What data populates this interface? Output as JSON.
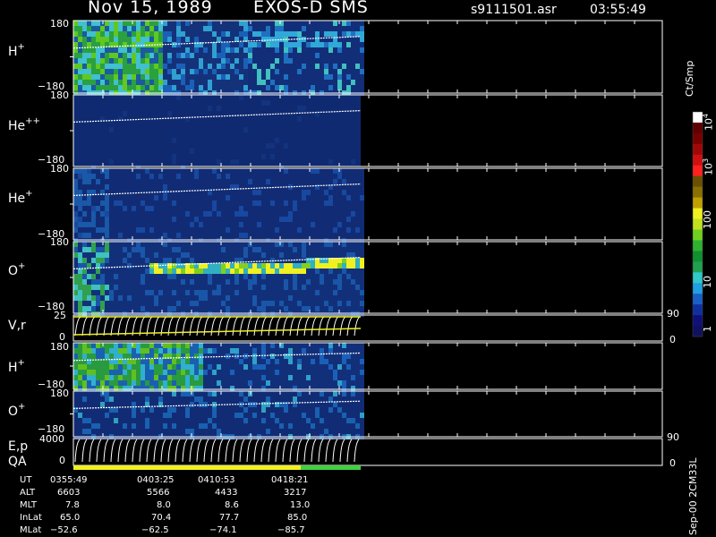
{
  "header": {
    "date": "Nov 15, 1989",
    "instrument": "EXOS-D SMS",
    "file": "s9111501.asr",
    "time": "03:55:49"
  },
  "colorbar": {
    "unit_label": "Ct/Smp",
    "tick_labels": [
      "1",
      "10",
      "100",
      "10",
      "10"
    ],
    "tick_exponents": [
      "",
      "",
      "",
      "3",
      "4"
    ],
    "colors": [
      "#101060",
      "#101078",
      "#1030a0",
      "#1860c8",
      "#20a0e0",
      "#30c8c8",
      "#20a050",
      "#109030",
      "#30b030",
      "#70d020",
      "#c0e020",
      "#f0f020",
      "#c0a000",
      "#8a7000",
      "#6a5000",
      "#ff2020",
      "#d01010",
      "#a00808",
      "#780000",
      "#600000",
      "#ffffff"
    ]
  },
  "side_label": "Sep-00 2CM33L",
  "panels": [
    {
      "label": "H",
      "sup": "+",
      "ymax": "180",
      "ymin": "−180",
      "color_theme": "green"
    },
    {
      "label": "He",
      "sup": "++",
      "ymax": "180",
      "ymin": "−180",
      "color_theme": "dark"
    },
    {
      "label": "He",
      "sup": "+",
      "ymax": "180",
      "ymin": "−180",
      "color_theme": "dark"
    },
    {
      "label": "O",
      "sup": "+",
      "ymax": "180",
      "ymin": "−180",
      "color_theme": "mixed"
    },
    {
      "label": "H",
      "sup": "+",
      "ymax": "180",
      "ymin": "−180",
      "color_theme": "green"
    },
    {
      "label": "O",
      "sup": "+",
      "ymax": "180",
      "ymin": "−180",
      "color_theme": "dark"
    }
  ],
  "vr_panel": {
    "label": "V,r",
    "ymax": "25",
    "ymin": "0",
    "right_top": "90",
    "right_bottom": "0"
  },
  "ep_panel": {
    "label1": "E,p",
    "label2": "QA",
    "ymax": "4000",
    "ymin": "0",
    "right_top": "90",
    "right_bottom": "0"
  },
  "footer": {
    "rows": [
      {
        "name": "UT",
        "values": [
          "0355:49",
          "0403:25",
          "0410:53",
          "0418:21"
        ]
      },
      {
        "name": "ALT",
        "values": [
          "6603",
          "5566",
          "4433",
          "3217"
        ]
      },
      {
        "name": "MLT",
        "values": [
          "7.8",
          "8.0",
          "8.6",
          "13.0"
        ]
      },
      {
        "name": "InLat",
        "values": [
          "65.0",
          "70.4",
          "77.7",
          "85.0"
        ]
      },
      {
        "name": "MLat",
        "values": [
          "−52.6",
          "−62.5",
          "−74.1",
          "−85.7"
        ]
      }
    ]
  },
  "chart_data": {
    "type": "heatmap",
    "title": "Nov 15, 1989   EXOS-D SMS",
    "panels": [
      "H+",
      "He++",
      "He+",
      "O+",
      "V,r",
      "H+",
      "O+",
      "E,p QA"
    ],
    "y_range_pitch_angle": [
      -180,
      180
    ],
    "time_ticks": [
      "0355:49",
      "0403:25",
      "0410:53",
      "0418:21"
    ],
    "colorbar_scale": "log",
    "colorbar_range": [
      1,
      10000
    ],
    "colorbar_unit": "Ct/Smp"
  }
}
